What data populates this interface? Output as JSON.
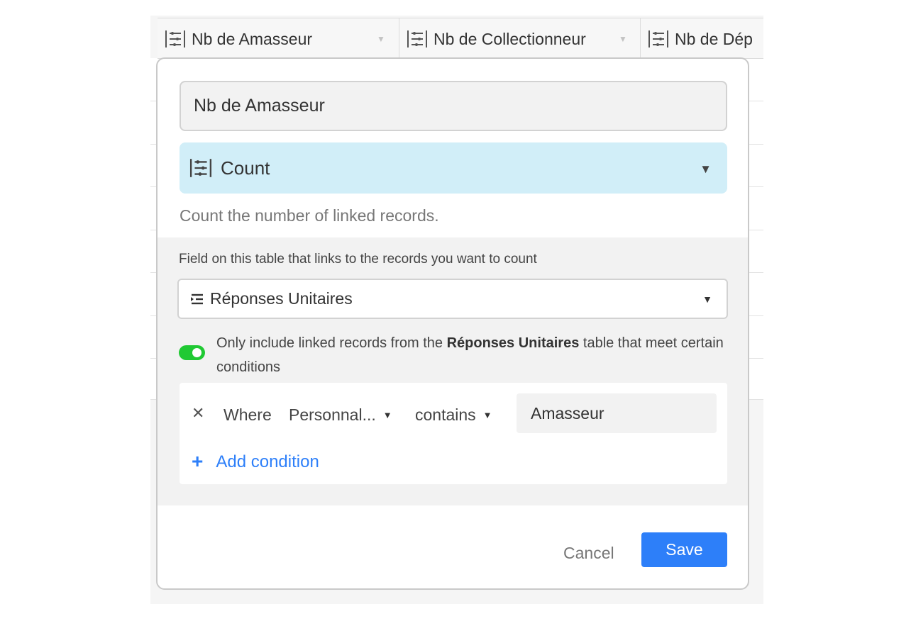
{
  "grid": {
    "columns": [
      {
        "label": "Nb de Amasseur",
        "icon": "count-icon"
      },
      {
        "label": "Nb de Collectionneur",
        "icon": "count-icon"
      },
      {
        "label": "Nb de Dép",
        "icon": "count-icon"
      }
    ]
  },
  "editor": {
    "field_name": "Nb de Amasseur",
    "field_type": {
      "label": "Count",
      "icon": "count-icon"
    },
    "type_description": "Count the number of linked records.",
    "link_field_label": "Field on this table that links to the records you want to count",
    "link_field": {
      "label": "Réponses Unitaires",
      "icon": "linked-records-icon"
    },
    "filter_toggle": {
      "on": true,
      "text_before": "Only include linked records from the ",
      "table_name": "Réponses Unitaires",
      "text_after": " table that meet certain conditions"
    },
    "condition": {
      "where_label": "Where",
      "field": "Personnal...",
      "operator": "contains",
      "value": "Amasseur"
    },
    "add_condition_label": "Add condition",
    "cancel_label": "Cancel",
    "save_label": "Save",
    "colors": {
      "accent": "#2d7ff9",
      "type_bg": "#d1eef8",
      "toggle_on": "#20c933"
    }
  }
}
